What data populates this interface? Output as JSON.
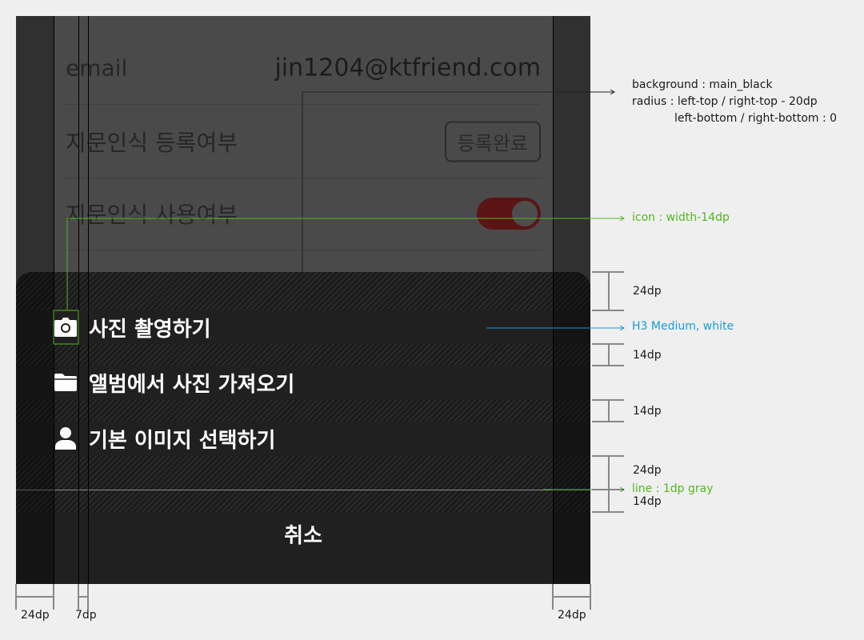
{
  "settings": {
    "email": {
      "label": "email",
      "value": "jin1204@ktfriend.com"
    },
    "fingerprint_register": {
      "label": "지문인식 등록여부",
      "status": "등록완료"
    },
    "fingerprint_use": {
      "label": "지문인식 사용여부",
      "toggle_on": true
    }
  },
  "sheet": {
    "items": [
      {
        "icon": "camera-icon",
        "label": "사진 촬영하기"
      },
      {
        "icon": "folder-icon",
        "label": "앨범에서 사진 가져오기"
      },
      {
        "icon": "person-icon",
        "label": "기본 이미지 선택하기"
      }
    ],
    "cancel_label": "취소"
  },
  "annotations": {
    "background_spec": "background : main_black",
    "radius_top_spec": "radius : left-top / right-top -  20dp",
    "radius_bottom_spec": "left-bottom / right-bottom : 0",
    "icon_spec": "icon : width-14dp",
    "text_spec": "H3 Medium, white",
    "line_spec": "line : 1dp gray",
    "dims": {
      "top_padding": "24dp",
      "gap_1": "14dp",
      "gap_2": "14dp",
      "bottom_padding": "24dp",
      "line_gap": "14dp",
      "left_margin": "24dp",
      "icon_gap": "7dp",
      "right_margin": "24dp"
    }
  },
  "colors": {
    "sheet_bg": "#202020",
    "annotation_green": "#52b81e",
    "annotation_blue": "#1a9ad6",
    "toggle_on": "#5b1414"
  }
}
